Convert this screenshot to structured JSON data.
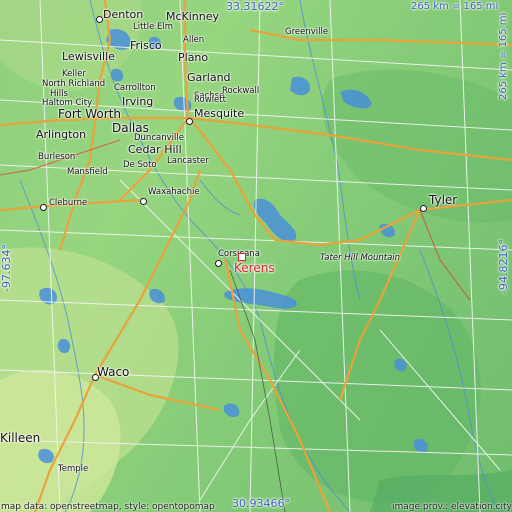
{
  "coords": {
    "top": "33.31622°",
    "bottom": "30.93466°",
    "left": "-97.634°",
    "right": "-94.8216°"
  },
  "scale": {
    "horizontal": "265 km = 165 mi",
    "vertical": "265 km = 165 mi"
  },
  "target": {
    "name": "Kerens",
    "marker_icon": "square-marker-icon",
    "color": "#d8262c"
  },
  "cities": {
    "denton": "Denton",
    "mckinney": "McKinney",
    "little_elm": "Little Elm",
    "frisco": "Frisco",
    "allen": "Allen",
    "greenville": "Greenville",
    "lewisville": "Lewisville",
    "plano": "Plano",
    "keller": "Keller",
    "carrollton": "Carrollton",
    "garland": "Garland",
    "north_richland": "North Richland",
    "sachse": "Sachse",
    "hills": "Hills",
    "rockwall": "Rockwall",
    "irving": "Irving",
    "haltom_city": "Haltom City",
    "rowlett": "Rowlett",
    "fort_worth": "Fort Worth",
    "dallas": "Dallas",
    "mesquite": "Mesquite",
    "arlington": "Arlington",
    "cedar_hill": "Cedar Hill",
    "duncanville": "Duncanville",
    "burleson": "Burleson",
    "lancaster": "Lancaster",
    "mansfield": "Mansfield",
    "de_soto": "De Soto",
    "waxahachie": "Waxahachie",
    "cleburne": "Cleburne",
    "tyler": "Tyler",
    "corsicana": "Corsicana",
    "tater_hill": "Tater Hill Mountain",
    "waco": "Waco",
    "killeen": "Killeen",
    "temple": "Temple"
  },
  "attribution": {
    "left": "map data: openstreetmap, style: opentopomap",
    "right": "image prov.: elevation.city"
  },
  "colors": {
    "water": "#4a90d9",
    "highway": "#e8a33a",
    "road": "#f5f5f5",
    "coord_text": "#3b63b8"
  }
}
